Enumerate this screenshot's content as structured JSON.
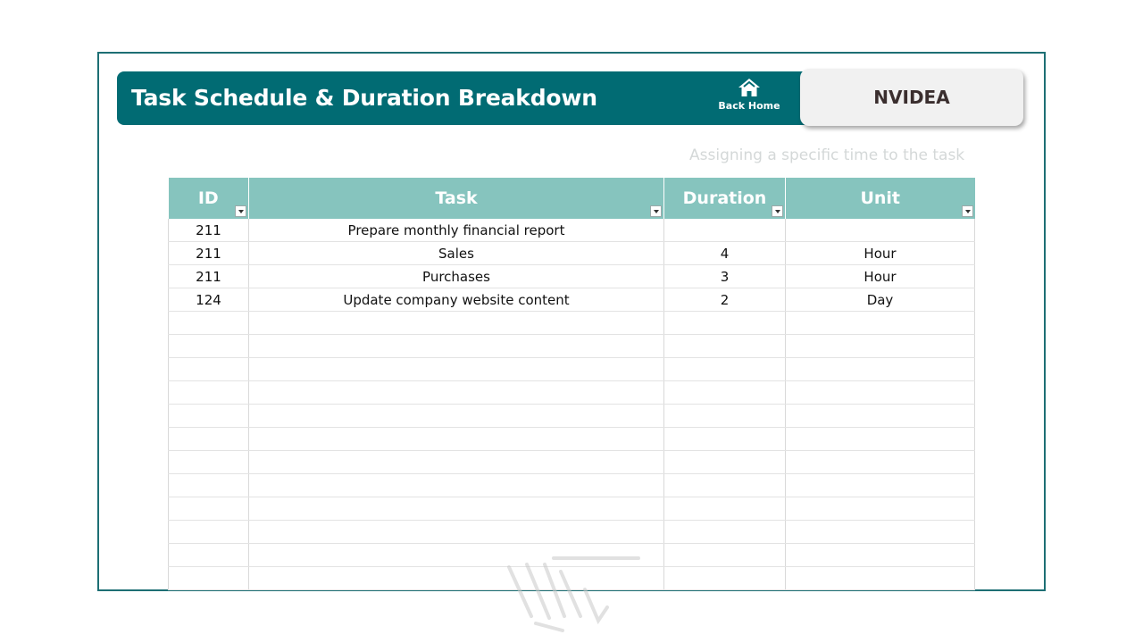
{
  "header": {
    "title": "Task Schedule & Duration Breakdown",
    "back_home_label": "Back Home",
    "company": "NVIDEA",
    "subtitle": "Assigning a specific time to the task"
  },
  "colors": {
    "header_bg": "#016b73",
    "table_header_bg": "#86c4be",
    "frame_border": "#1d6f74"
  },
  "table": {
    "columns": [
      "ID",
      "Task",
      "Duration",
      "Unit"
    ],
    "rows": [
      [
        "211",
        "Prepare monthly financial report",
        "",
        ""
      ],
      [
        "211",
        "Sales",
        "4",
        "Hour"
      ],
      [
        "211",
        "Purchases",
        "3",
        "Hour"
      ],
      [
        "124",
        "Update company website content",
        "2",
        "Day"
      ],
      [
        "",
        "",
        "",
        ""
      ],
      [
        "",
        "",
        "",
        ""
      ],
      [
        "",
        "",
        "",
        ""
      ],
      [
        "",
        "",
        "",
        ""
      ],
      [
        "",
        "",
        "",
        ""
      ],
      [
        "",
        "",
        "",
        ""
      ],
      [
        "",
        "",
        "",
        ""
      ],
      [
        "",
        "",
        "",
        ""
      ],
      [
        "",
        "",
        "",
        ""
      ],
      [
        "",
        "",
        "",
        ""
      ],
      [
        "",
        "",
        "",
        ""
      ],
      [
        "",
        "",
        "",
        ""
      ]
    ]
  },
  "icons": {
    "home": "home-icon",
    "filter": "filter-dropdown-icon",
    "watermark": "watermark-logo"
  }
}
